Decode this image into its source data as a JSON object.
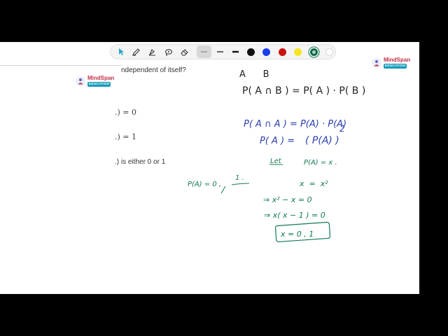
{
  "slide": {
    "question_fragment": "ndependent of itself?",
    "option_1": ".) = 0",
    "option_2": ".) = 1",
    "option_3": ".) is either 0 or 1"
  },
  "branding": {
    "logo_name": "MindSpan",
    "logo_tag": "EDUCATION"
  },
  "toolbar": {
    "tools": [
      "pointer-tool",
      "pen-tool",
      "highlighter-tool",
      "lasso-tool",
      "eraser-tool"
    ],
    "strokes": [
      "thin",
      "medium",
      "thick"
    ],
    "selected_stroke": "thin",
    "colors": [
      {
        "name": "black",
        "hex": "#111111"
      },
      {
        "name": "blue",
        "hex": "#1a3df0"
      },
      {
        "name": "red",
        "hex": "#cc1111"
      },
      {
        "name": "yellow",
        "hex": "#f4e61c"
      },
      {
        "name": "green",
        "hex": "#0b6b47"
      },
      {
        "name": "white",
        "hex": "#ffffff"
      }
    ],
    "selected_color": "green"
  },
  "annotations": {
    "black_ink": {
      "line_1": "A      B",
      "line_2": "P( A ∩ B )  =  P( A ) · P( B )"
    },
    "blue_ink": {
      "line_1": "P( A ∩ A )  =  P(A) · P(A)",
      "line_2a": "P( A )  =",
      "line_2b": "( P(A) )",
      "line_2_exp": "2"
    },
    "green_ink": {
      "let": "Let",
      "let_expr": "P(A) = x .",
      "eq_1": "x  =  x²",
      "eq_2": "⇒  x² − x = 0",
      "eq_3": "⇒  x( x − 1 ) = 0",
      "answer": "x = 0 , 1",
      "side_expr": "P(A) = 0 ,",
      "side_one": "1 ."
    }
  }
}
